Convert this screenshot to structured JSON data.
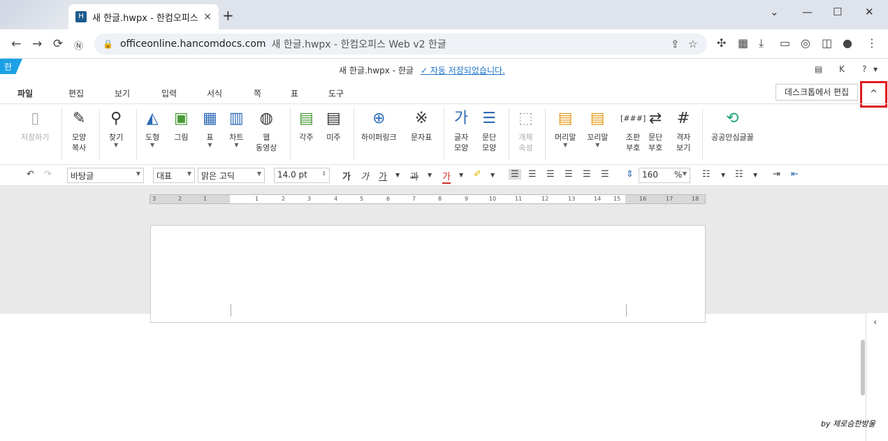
{
  "browser": {
    "tab_title": "새 한글.hwpx - 한컴오피스 W",
    "tab_close": "×",
    "new_tab": "+",
    "url": "officeonline.hancomdocs.com",
    "url_rest": "새 한글.hwpx - 한컴오피스 Web v2 한글"
  },
  "app": {
    "logo": "한",
    "doc_title": "새 한글.hwpx - 한글",
    "saved_status": "✓ 자동 저장되었습니다.",
    "user_initial": "K",
    "help": "?",
    "menus": [
      "파일",
      "편집",
      "보기",
      "입력",
      "서식",
      "쪽",
      "표",
      "도구"
    ],
    "desktop_edit": "데스크톱에서 편집",
    "collapse": "^"
  },
  "ribbon": {
    "save": [
      "저장하기"
    ],
    "copy_format": [
      "모양",
      "복사"
    ],
    "find": [
      "찾기"
    ],
    "shape": [
      "도형"
    ],
    "picture": [
      "그림"
    ],
    "table": [
      "표"
    ],
    "chart": [
      "차트"
    ],
    "web_video": [
      "웹",
      "동영상"
    ],
    "footnote": [
      "각주"
    ],
    "endnote": [
      "미주"
    ],
    "hyperlink": [
      "하이퍼링크"
    ],
    "charmap": [
      "문자표"
    ],
    "char_shape": [
      "글자",
      "모양"
    ],
    "para_shape": [
      "문단",
      "모양"
    ],
    "object_prop": [
      "개체",
      "속성"
    ],
    "header": [
      "머리말"
    ],
    "footer": [
      "꼬리말"
    ],
    "compose_code": [
      "조판",
      "부호"
    ],
    "para_mark": [
      "문단",
      "부호"
    ],
    "grid_view": [
      "격자",
      "보기"
    ],
    "safe_font": [
      "공공안심글꼴"
    ]
  },
  "format": {
    "style": "바탕글",
    "lang": "대표",
    "font": "맑은 고딕",
    "size": "14.0",
    "size_unit": "pt",
    "line_spacing": "160",
    "line_unit": "%",
    "bold_glyph": "가",
    "italic_glyph": "가",
    "underline_glyph": "가",
    "strike_glyph": "과",
    "color_glyph": "가"
  },
  "ruler": {
    "ticks": [
      "3",
      "2",
      "1",
      "1",
      "2",
      "3",
      "4",
      "5",
      "6",
      "7",
      "8",
      "9",
      "10",
      "11",
      "12",
      "13",
      "14",
      "15",
      "16",
      "17",
      "18"
    ]
  },
  "watermark": "by 제로슴한방울",
  "colors": {
    "accent": "#1da1e6",
    "highlight": "#e0191e"
  }
}
